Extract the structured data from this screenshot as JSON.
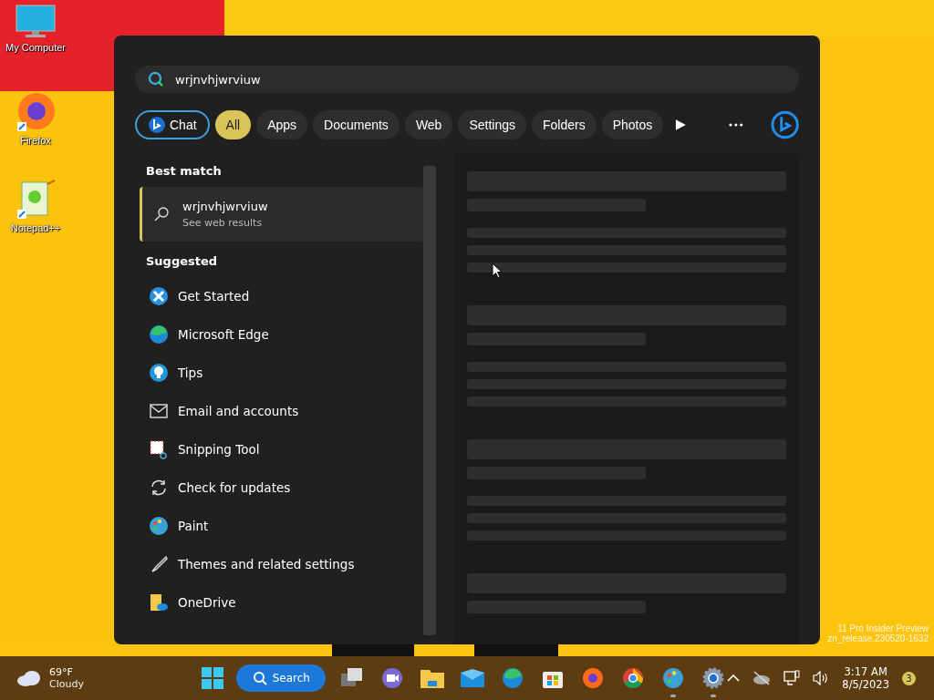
{
  "desktop_icons": [
    {
      "label": "My Computer",
      "kind": "monitor"
    },
    {
      "label": "Firefox",
      "kind": "firefox"
    },
    {
      "label": "Notepad++",
      "kind": "notepad"
    }
  ],
  "search_panel": {
    "query": "wrjnvhjwrviuw",
    "filters": [
      {
        "label": "Chat",
        "kind": "chat",
        "selected": false
      },
      {
        "label": "All",
        "kind": "text",
        "selected": true
      },
      {
        "label": "Apps",
        "kind": "text",
        "selected": false
      },
      {
        "label": "Documents",
        "kind": "text",
        "selected": false
      },
      {
        "label": "Web",
        "kind": "text",
        "selected": false
      },
      {
        "label": "Settings",
        "kind": "text",
        "selected": false
      },
      {
        "label": "Folders",
        "kind": "text",
        "selected": false
      },
      {
        "label": "Photos",
        "kind": "text",
        "selected": false
      }
    ],
    "best_match_heading": "Best match",
    "best_match": {
      "title": "wrjnvhjwrviuw",
      "subtitle": "See web results",
      "selected": true
    },
    "suggested_heading": "Suggested",
    "suggested": [
      {
        "label": "Get Started",
        "kind": "getstarted"
      },
      {
        "label": "Microsoft Edge",
        "kind": "edge"
      },
      {
        "label": "Tips",
        "kind": "tips"
      },
      {
        "label": "Email and accounts",
        "kind": "mail"
      },
      {
        "label": "Snipping Tool",
        "kind": "snip"
      },
      {
        "label": "Check for updates",
        "kind": "sync"
      },
      {
        "label": "Paint",
        "kind": "paint"
      },
      {
        "label": "Themes and related settings",
        "kind": "brush"
      },
      {
        "label": "OneDrive",
        "kind": "onedrive"
      }
    ]
  },
  "watermark": {
    "line_1": "11 Pro Insider Preview",
    "line_2": "zn_release.230520-1632"
  },
  "taskbar": {
    "weather": {
      "temperature": "69°F",
      "condition": "Cloudy"
    },
    "search_label": "Search",
    "apps": [
      {
        "kind": "taskview",
        "running": false
      },
      {
        "kind": "teams",
        "running": false
      },
      {
        "kind": "explorer",
        "running": false
      },
      {
        "kind": "mail",
        "running": false
      },
      {
        "kind": "edge",
        "running": false
      },
      {
        "kind": "store",
        "running": false
      },
      {
        "kind": "firefox",
        "running": false
      },
      {
        "kind": "chrome",
        "running": false
      },
      {
        "kind": "paint",
        "running": true
      },
      {
        "kind": "settings",
        "running": true
      }
    ],
    "time": "3:17 AM",
    "date": "8/5/2023",
    "notifications": "3"
  }
}
